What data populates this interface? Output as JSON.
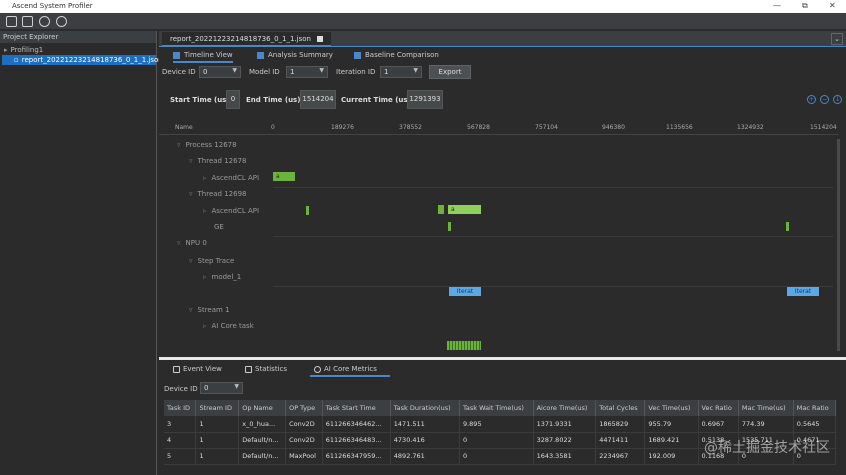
{
  "window": {
    "title": "Ascend System Profiler",
    "controls": [
      "—",
      "⧉",
      "✕"
    ]
  },
  "explorer": {
    "header": "Project Explorer",
    "root": "Profiling1",
    "file": "report_20221223214818736_0_1_1.json"
  },
  "editor": {
    "file_tab": "report_20221223214818736_0_1_1.json",
    "collapse": "⌄",
    "view_tabs": [
      "Timeline View",
      "Analysis Summary",
      "Baseline Comparison"
    ],
    "filters": {
      "device_label": "Device ID",
      "device_value": "0",
      "model_label": "Model ID",
      "model_value": "1",
      "iter_label": "Iteration ID",
      "iter_value": "1",
      "export": "Export"
    },
    "time": {
      "start_label": "Start Time (us):",
      "start_value": "0",
      "end_label": "End Time (us):",
      "end_value": "1514204",
      "current_label": "Current Time (us):",
      "current_value": "1291393"
    },
    "ruler": {
      "name": "Name",
      "ticks": [
        "0",
        "189276",
        "378552",
        "567828",
        "757104",
        "946380",
        "1135656",
        "1324932",
        "1514204"
      ]
    },
    "rows": {
      "process": "Process 12678",
      "thread1": "Thread 12678",
      "acl1": "AscendCL API",
      "thread2": "Thread 12698",
      "acl2": "AscendCL API",
      "ge": "GE",
      "npu": "NPU 0",
      "step_trace": "Step Trace",
      "model": "model_1",
      "stream": "Stream 1",
      "aicore": "AI Core task"
    },
    "bars": {
      "a1": "a",
      "a2": "a",
      "iter1": "Iterat",
      "iter2": "Iterat"
    }
  },
  "bottom": {
    "tabs": [
      "Event View",
      "Statistics",
      "AI Core Metrics"
    ],
    "device_label": "Device ID",
    "device_value": "0",
    "columns": [
      "Task ID",
      "Stream ID",
      "Op Name",
      "OP Type",
      "Task Start Time",
      "Task Duration(us)",
      "Task Wait Time(us)",
      "Aicore Time(us)",
      "Total Cycles",
      "Vec Time(us)",
      "Vec Ratio",
      "Mac Time(us)",
      "Mac Ratio"
    ],
    "rows": [
      [
        "3",
        "1",
        "x_0_hua...",
        "Conv2D",
        "611266346462...",
        "1471.511",
        "9.895",
        "1371.9331",
        "1865829",
        "955.79",
        "0.6967",
        "774.39",
        "0.5645"
      ],
      [
        "4",
        "1",
        "Default/n...",
        "Conv2D",
        "611266346483...",
        "4730.416",
        "0",
        "3287.8022",
        "4471411",
        "1689.421",
        "0.5138",
        "1535.711",
        "0.4671"
      ],
      [
        "5",
        "1",
        "Default/n...",
        "MaxPool",
        "611266347959...",
        "4892.761",
        "0",
        "1643.3581",
        "2234967",
        "192.009",
        "0.1168",
        "0",
        "0"
      ]
    ]
  },
  "watermark": "@稀土掘金技术社区"
}
